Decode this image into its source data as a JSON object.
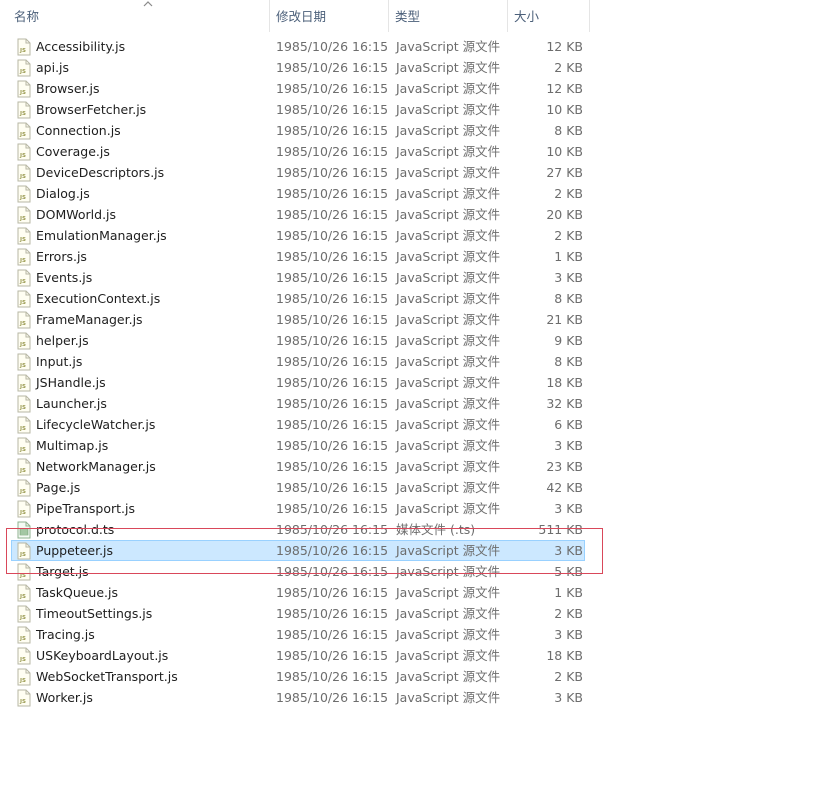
{
  "columns": {
    "name": "名称",
    "date": "修改日期",
    "type": "类型",
    "size": "大小",
    "sort_icon": "sort-up-chevron"
  },
  "files": [
    {
      "name": "Accessibility.js",
      "date": "1985/10/26 16:15",
      "type": "JavaScript 源文件",
      "size": "12 KB",
      "icon": "js"
    },
    {
      "name": "api.js",
      "date": "1985/10/26 16:15",
      "type": "JavaScript 源文件",
      "size": "2 KB",
      "icon": "js"
    },
    {
      "name": "Browser.js",
      "date": "1985/10/26 16:15",
      "type": "JavaScript 源文件",
      "size": "12 KB",
      "icon": "js"
    },
    {
      "name": "BrowserFetcher.js",
      "date": "1985/10/26 16:15",
      "type": "JavaScript 源文件",
      "size": "10 KB",
      "icon": "js"
    },
    {
      "name": "Connection.js",
      "date": "1985/10/26 16:15",
      "type": "JavaScript 源文件",
      "size": "8 KB",
      "icon": "js"
    },
    {
      "name": "Coverage.js",
      "date": "1985/10/26 16:15",
      "type": "JavaScript 源文件",
      "size": "10 KB",
      "icon": "js"
    },
    {
      "name": "DeviceDescriptors.js",
      "date": "1985/10/26 16:15",
      "type": "JavaScript 源文件",
      "size": "27 KB",
      "icon": "js"
    },
    {
      "name": "Dialog.js",
      "date": "1985/10/26 16:15",
      "type": "JavaScript 源文件",
      "size": "2 KB",
      "icon": "js"
    },
    {
      "name": "DOMWorld.js",
      "date": "1985/10/26 16:15",
      "type": "JavaScript 源文件",
      "size": "20 KB",
      "icon": "js"
    },
    {
      "name": "EmulationManager.js",
      "date": "1985/10/26 16:15",
      "type": "JavaScript 源文件",
      "size": "2 KB",
      "icon": "js"
    },
    {
      "name": "Errors.js",
      "date": "1985/10/26 16:15",
      "type": "JavaScript 源文件",
      "size": "1 KB",
      "icon": "js"
    },
    {
      "name": "Events.js",
      "date": "1985/10/26 16:15",
      "type": "JavaScript 源文件",
      "size": "3 KB",
      "icon": "js"
    },
    {
      "name": "ExecutionContext.js",
      "date": "1985/10/26 16:15",
      "type": "JavaScript 源文件",
      "size": "8 KB",
      "icon": "js"
    },
    {
      "name": "FrameManager.js",
      "date": "1985/10/26 16:15",
      "type": "JavaScript 源文件",
      "size": "21 KB",
      "icon": "js"
    },
    {
      "name": "helper.js",
      "date": "1985/10/26 16:15",
      "type": "JavaScript 源文件",
      "size": "9 KB",
      "icon": "js"
    },
    {
      "name": "Input.js",
      "date": "1985/10/26 16:15",
      "type": "JavaScript 源文件",
      "size": "8 KB",
      "icon": "js"
    },
    {
      "name": "JSHandle.js",
      "date": "1985/10/26 16:15",
      "type": "JavaScript 源文件",
      "size": "18 KB",
      "icon": "js"
    },
    {
      "name": "Launcher.js",
      "date": "1985/10/26 16:15",
      "type": "JavaScript 源文件",
      "size": "32 KB",
      "icon": "js"
    },
    {
      "name": "LifecycleWatcher.js",
      "date": "1985/10/26 16:15",
      "type": "JavaScript 源文件",
      "size": "6 KB",
      "icon": "js"
    },
    {
      "name": "Multimap.js",
      "date": "1985/10/26 16:15",
      "type": "JavaScript 源文件",
      "size": "3 KB",
      "icon": "js"
    },
    {
      "name": "NetworkManager.js",
      "date": "1985/10/26 16:15",
      "type": "JavaScript 源文件",
      "size": "23 KB",
      "icon": "js"
    },
    {
      "name": "Page.js",
      "date": "1985/10/26 16:15",
      "type": "JavaScript 源文件",
      "size": "42 KB",
      "icon": "js"
    },
    {
      "name": "PipeTransport.js",
      "date": "1985/10/26 16:15",
      "type": "JavaScript 源文件",
      "size": "3 KB",
      "icon": "js"
    },
    {
      "name": "protocol.d.ts",
      "date": "1985/10/26 16:15",
      "type": "媒体文件 (.ts)",
      "size": "511 KB",
      "icon": "media"
    },
    {
      "name": "Puppeteer.js",
      "date": "1985/10/26 16:15",
      "type": "JavaScript 源文件",
      "size": "3 KB",
      "icon": "js",
      "selected": true
    },
    {
      "name": "Target.js",
      "date": "1985/10/26 16:15",
      "type": "JavaScript 源文件",
      "size": "5 KB",
      "icon": "js"
    },
    {
      "name": "TaskQueue.js",
      "date": "1985/10/26 16:15",
      "type": "JavaScript 源文件",
      "size": "1 KB",
      "icon": "js"
    },
    {
      "name": "TimeoutSettings.js",
      "date": "1985/10/26 16:15",
      "type": "JavaScript 源文件",
      "size": "2 KB",
      "icon": "js"
    },
    {
      "name": "Tracing.js",
      "date": "1985/10/26 16:15",
      "type": "JavaScript 源文件",
      "size": "3 KB",
      "icon": "js"
    },
    {
      "name": "USKeyboardLayout.js",
      "date": "1985/10/26 16:15",
      "type": "JavaScript 源文件",
      "size": "18 KB",
      "icon": "js"
    },
    {
      "name": "WebSocketTransport.js",
      "date": "1985/10/26 16:15",
      "type": "JavaScript 源文件",
      "size": "2 KB",
      "icon": "js"
    },
    {
      "name": "Worker.js",
      "date": "1985/10/26 16:15",
      "type": "JavaScript 源文件",
      "size": "3 KB",
      "icon": "js"
    }
  ],
  "colors": {
    "selection_bg": "#cce8ff",
    "selection_border": "#99d1ff",
    "highlight_box": "#d9485a",
    "header_text": "#4c607a"
  }
}
